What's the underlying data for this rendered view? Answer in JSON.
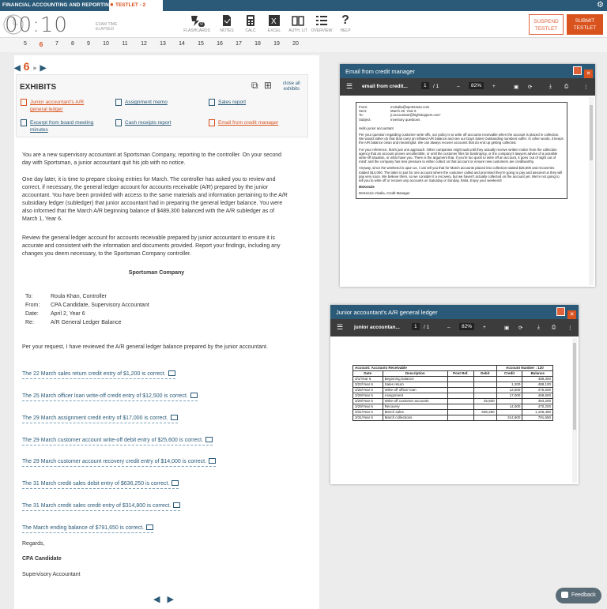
{
  "topbar": {
    "course": "FINANCIAL ACCOUNTING AND REPORTING",
    "testlet": "TESTLET - 2"
  },
  "toolbar": {
    "timer": "00:10",
    "timer_label_1": "EXAM TIME",
    "timer_label_2": "ELAPSED",
    "tools": [
      "FLASHCARDS",
      "NOTES",
      "CALC",
      "EXCEL",
      "AUTH. LIT",
      "OVERVIEW",
      "HELP"
    ],
    "flashcard_badge": "0",
    "suspend_1": "SUSPEND",
    "suspend_2": "TESTLET",
    "submit_1": "SUBMIT",
    "submit_2": "TESTLET"
  },
  "question_numbers": [
    "5",
    "6",
    "7",
    "8",
    "9",
    "10",
    "11",
    "12",
    "13",
    "14",
    "15",
    "16",
    "17",
    "18",
    "19",
    "20"
  ],
  "current_question": "6",
  "exhibits": {
    "title": "EXHIBITS",
    "close_all_1": "close all",
    "close_all_2": "exhibits",
    "items": [
      {
        "line1": "Junior accountant's A/R",
        "line2": "general ledger"
      },
      {
        "line1": "Assignment memo",
        "line2": ""
      },
      {
        "line1": "Sales report",
        "line2": ""
      },
      {
        "line1": "Excerpt from board meeting",
        "line2": "minutes"
      },
      {
        "line1": "Cash receipts report",
        "line2": ""
      },
      {
        "line1": "Email from credit manager",
        "line2": ""
      }
    ]
  },
  "question": {
    "p1": "You are a new supervisory accountant at Sportsman Company, reporting to the controller.  On your second day with Sportsman, a junior accountant quit his job with no notice.",
    "p2": "One day later, it is time to prepare closing entries for March.  The controller has asked you to review and correct, if necessary, the general ledger account for accounts receivable (A/R) prepared by the junior accountant.  You have been provided with access to the same materials and information pertaining to the A/R subsidiary ledger (subledger) that junior accountant had in preparing the general ledger balance.  You were also informed that the March A/R beginning balance of $489,300 balanced with the A/R subledger as of March 1, Year 6.",
    "p3": "Review the general ledger account for accounts receivable prepared by junior accountant to ensure it is accurate and consistent with the information and documents provided. Report your findings, including any changes you deem necessary, to the Sportsman Company controller.",
    "company": "Sportsman Company"
  },
  "memo": {
    "to_k": "To:",
    "to_v": "Roula Khan, Controller",
    "from_k": "From:",
    "from_v": "CPA Candidate, Supervisory Accountant",
    "date_k": "Date:",
    "date_v": "April 2, Year 6",
    "re_k": "Re:",
    "re_v": "A/R General Ledger Balance",
    "intro": "Per your request, I have reviewed the A/R general ledger balance prepared by the junior accountant.",
    "responses": [
      "The 22 March sales return credit entry of $1,200 is correct.",
      "The 25 March officer loan write-off credit entry of $12,500 is correct.",
      "The 29 March assignment credit entry of $17,000 is correct.",
      "The 29 March customer account write-off debit entry of $25,600 is correct.",
      "The 29 March customer account recovery credit entry of $14,000 is correct.",
      "The 31 March credit sales debit entry of $636,250 is correct.",
      "The 31 March credit sales credit entry of $314,800 is correct.",
      "The March ending balance of $791,650 is correct."
    ],
    "regards": "Regards,",
    "sign": "CPA Candidate",
    "title": "Supervisory Accountant"
  },
  "email_panel": {
    "title": "Email from credit manager",
    "file": "email from credit...",
    "page": "1",
    "pages": "/ 1",
    "zoom": "82%",
    "from_k": "From:",
    "from_v": "mvisalia@sportsman.com",
    "sent_k": "Sent:",
    "sent_v": "March 29, Year 6",
    "to_k": "To:",
    "to_v": "jr.accountant@highsteppers.com'",
    "subj_k": "Subject:",
    "subj_v": "Inventory questions",
    "greeting": "Hello junior accountant",
    "b1": "Per your question regarding customer write-offs, our policy is to write off accounts receivable when the account is placed in collection. We would rather do that than carry an inflated A/R balance and see our Days Sales Outstanding numbers suffer. In other words, it keeps the A/R balance clean and meaningful. We can always recover accounts that do end up getting collected.",
    "b2": "For your reference, that's just one approach. Other companies might wait until they actually receive written notice from the collection agency that an account proves uncollectible, or until the customer files for bankruptcy, or the company's lawyers advise of a possible write-off situation, or what have you. There is the argument that, if you're too quick to write off an account, it goes 'out of sight out of mind' and the company has less pressure to either collect on that account or ensure new customers are creditworthy.",
    "b3": "Anyway, since the weekend is upon us, I can tell you that for March accounts placed into collection totaled $25,600 and recoveries totaled $14,000. The latter is just for one account where the customer called and promised they're going to pay and assured us they will pay very soon. We believe them, so we consider it a recovery, but we haven't actually collected on the account yet. We're not going to tell you to write off or recover any accounts on Saturday or Sunday, haha. Enjoy your weekend!",
    "signoff": "McKenzie",
    "sig": "McKenzie Visalia, Credit Manager"
  },
  "ledger_panel": {
    "title": "Junior accountant's A/R general ledger",
    "file": "junior accountan...",
    "page": "1",
    "pages": "/ 1",
    "zoom": "82%",
    "account": "Account: Accounts Receivable",
    "account_number": "Account Number : 120",
    "headers": [
      "Date",
      "Description",
      "Post Ref.",
      "Debit",
      "Credit",
      "Balance"
    ],
    "rows": [
      [
        "3/1/Year 6",
        "Beginning balance",
        "",
        "",
        "",
        "489,300"
      ],
      [
        "3/22/Year 6",
        "Sales return",
        "",
        "",
        "1,200",
        "488,100"
      ],
      [
        "3/25/Year 6",
        "Write-off officer loan",
        "",
        "",
        "12,500",
        "475,600"
      ],
      [
        "3/29/Year 6",
        "Assignment",
        "",
        "",
        "17,000",
        "458,600"
      ],
      [
        "3/29/Year 6",
        "Write-off customer accounts",
        "",
        "25,600",
        "",
        "484,200"
      ],
      [
        "3/29/Year 6",
        "Recovery",
        "",
        "",
        "14,000",
        "470,200"
      ],
      [
        "3/31/Year 6",
        "March sales",
        "",
        "636,250",
        "",
        "1,106,450"
      ],
      [
        "3/31/Year 6",
        "March collections",
        "",
        "",
        "314,800",
        "791,650"
      ]
    ]
  },
  "feedback": "Feedback",
  "colors": {
    "navy": "#2a5a78",
    "orange": "#d9531e"
  }
}
